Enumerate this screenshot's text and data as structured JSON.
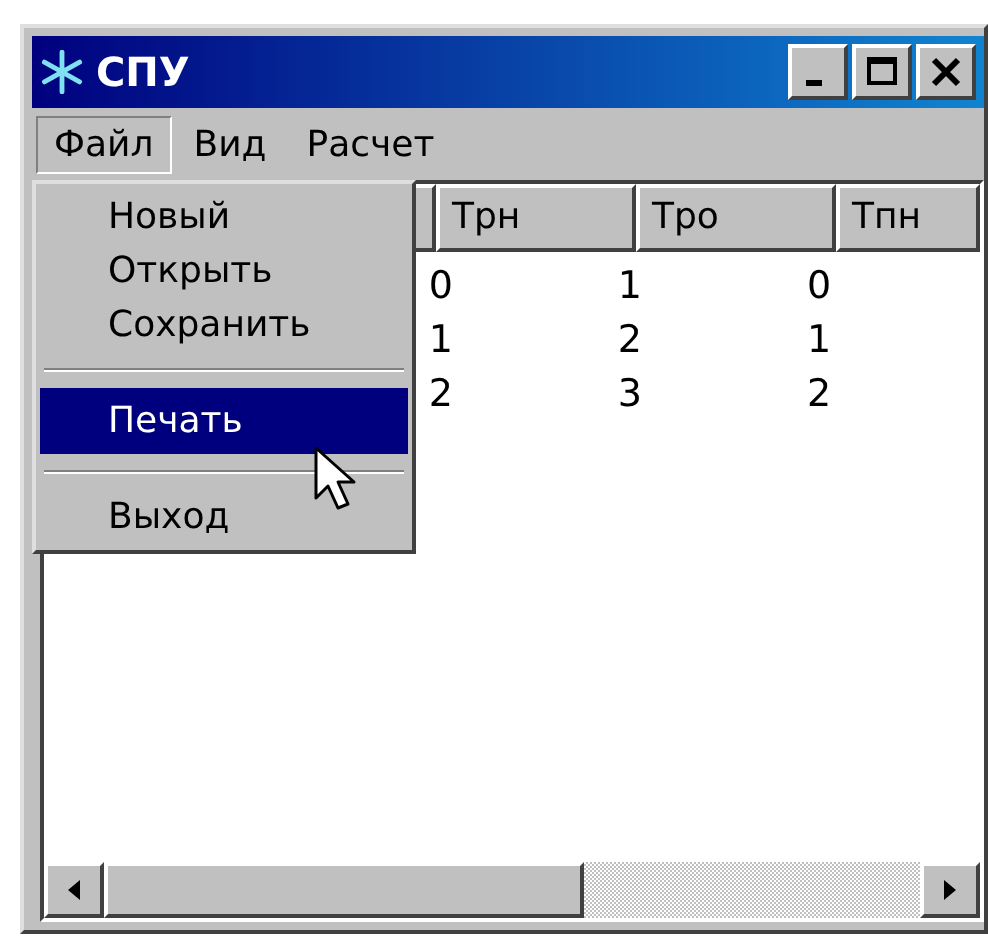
{
  "window": {
    "title": "СПУ"
  },
  "menu_bar": [
    {
      "label": "Файл",
      "selected": true
    },
    {
      "label": "Вид",
      "selected": false
    },
    {
      "label": "Расчет",
      "selected": false
    }
  ],
  "dropdown": [
    {
      "kind": "item",
      "label": "Новый",
      "selected": false
    },
    {
      "kind": "item",
      "label": "Открыть",
      "selected": false
    },
    {
      "kind": "item",
      "label": "Сохранить",
      "selected": false
    },
    {
      "kind": "separator"
    },
    {
      "kind": "item",
      "label": "Печать",
      "selected": true
    },
    {
      "kind": "separator"
    },
    {
      "kind": "item",
      "label": "Выход",
      "selected": false
    }
  ],
  "table": {
    "columns": [
      "Трн",
      "Тро",
      "Тпн"
    ],
    "rows": [
      [
        "0",
        "1",
        "0"
      ],
      [
        "1",
        "2",
        "1"
      ],
      [
        "2",
        "3",
        "2"
      ]
    ]
  }
}
